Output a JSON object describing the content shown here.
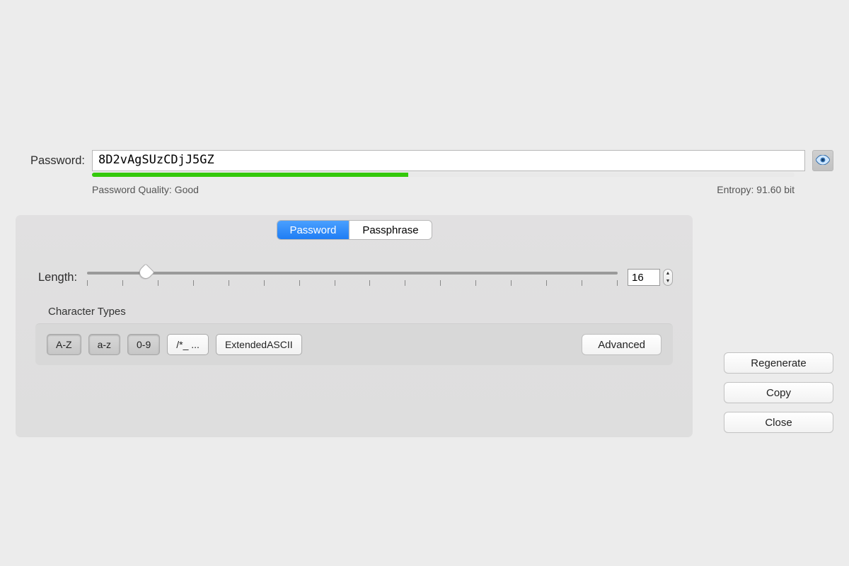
{
  "password": {
    "label": "Password:",
    "value": "8D2vAgSUzCDjJ5GZ",
    "quality_pct": 45,
    "quality_text": "Password Quality: Good",
    "entropy_text": "Entropy: 91.60 bit"
  },
  "tabs": {
    "password": "Password",
    "passphrase": "Passphrase",
    "active": "password"
  },
  "length": {
    "label": "Length:",
    "value": "16",
    "slider_pct": 11,
    "ticks": 16
  },
  "char_types": {
    "title": "Character Types",
    "items": [
      {
        "key": "upper",
        "label": "A-Z",
        "pressed": true
      },
      {
        "key": "lower",
        "label": "a-z",
        "pressed": true
      },
      {
        "key": "digits",
        "label": "0-9",
        "pressed": true
      },
      {
        "key": "symbols",
        "label": "/*_ ...",
        "pressed": false
      },
      {
        "key": "extascii",
        "label": "ExtendedASCII",
        "pressed": false
      }
    ],
    "advanced": "Advanced"
  },
  "buttons": {
    "regenerate": "Regenerate",
    "copy": "Copy",
    "close": "Close"
  }
}
